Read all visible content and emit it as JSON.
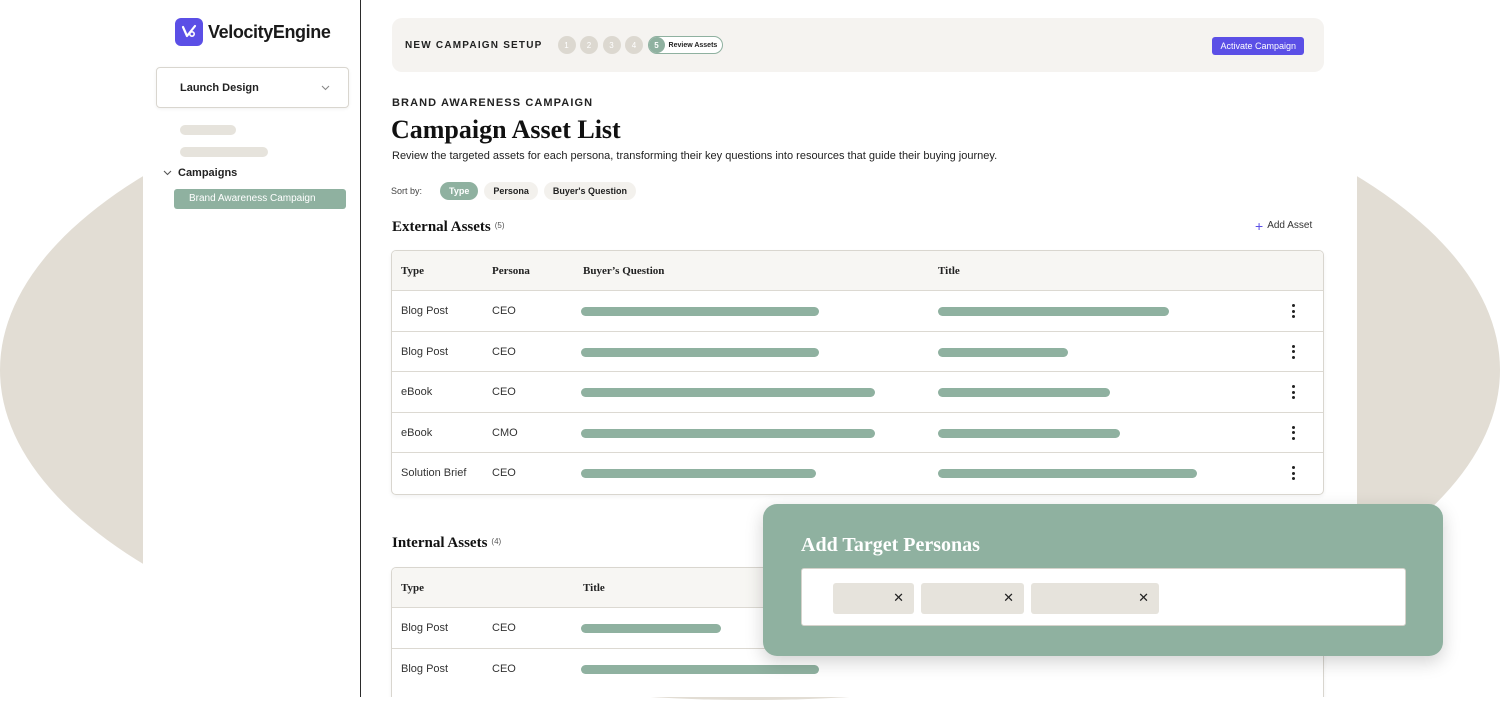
{
  "brand": {
    "name": "VelocityEngine",
    "accent": "#5b4fe6",
    "sage": "#8fb1a0"
  },
  "sidebar": {
    "project_select": "Launch Design",
    "group_label": "Campaigns",
    "active_item": "Brand Awareness Campaign"
  },
  "setup": {
    "title": "NEW CAMPAIGN SETUP",
    "steps": [
      "1",
      "2",
      "3",
      "4"
    ],
    "current_step": "5",
    "current_step_label": "Review Assets",
    "activate_label": "Activate Campaign"
  },
  "header": {
    "eyebrow": "BRAND AWARENESS CAMPAIGN",
    "title": "Campaign Asset List",
    "description": "Review the targeted assets for each persona, transforming their key questions into resources that guide their buying journey."
  },
  "sort": {
    "label": "Sort by:",
    "options": [
      "Type",
      "Persona",
      "Buyer's Question"
    ],
    "active": "Type"
  },
  "external": {
    "title": "External Assets",
    "count": "(5)",
    "add_label": "Add Asset",
    "columns": [
      "Type",
      "Persona",
      "Buyer’s Question",
      "Title"
    ],
    "rows": [
      {
        "type": "Blog Post",
        "persona": "CEO",
        "question_fill": 0.68,
        "title_fill": 0.66
      },
      {
        "type": "Blog Post",
        "persona": "CEO",
        "question_fill": 0.68,
        "title_fill": 0.37
      },
      {
        "type": "eBook",
        "persona": "CEO",
        "question_fill": 0.84,
        "title_fill": 0.49
      },
      {
        "type": "eBook",
        "persona": "CMO",
        "question_fill": 0.84,
        "title_fill": 0.52
      },
      {
        "type": "Solution Brief",
        "persona": "CEO",
        "question_fill": 0.67,
        "title_fill": 0.74
      }
    ]
  },
  "internal": {
    "title": "Internal Assets",
    "count": "(4)",
    "columns": [
      "Type",
      "Title"
    ],
    "rows": [
      {
        "type": "Blog Post",
        "persona": "CEO",
        "title_fill": 0.4
      },
      {
        "type": "Blog Post",
        "persona": "CEO",
        "title_fill": 0.68
      }
    ]
  },
  "personas_card": {
    "title": "Add Target Personas",
    "tags": [
      {
        "remove": "✕"
      },
      {
        "remove": "✕"
      },
      {
        "remove": "✕"
      }
    ]
  }
}
